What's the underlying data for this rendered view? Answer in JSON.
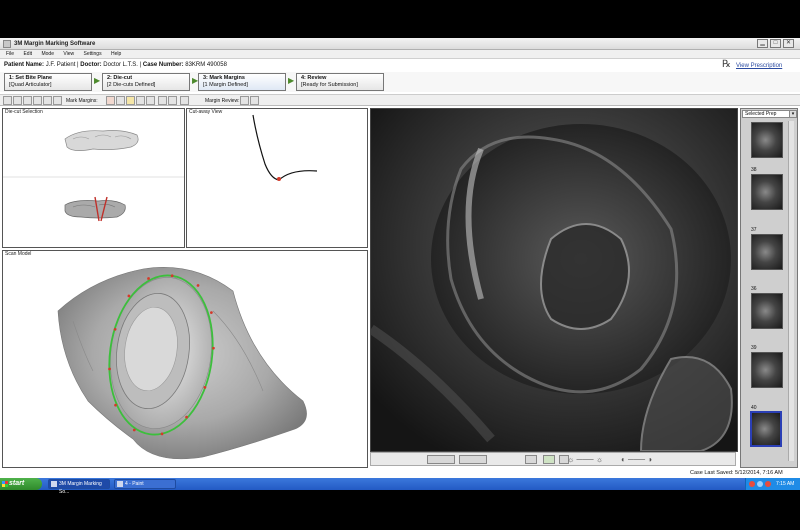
{
  "window": {
    "title": "3M Margin Marking Software"
  },
  "menu": [
    "File",
    "Edit",
    "Mode",
    "View",
    "Settings",
    "Help"
  ],
  "patient_bar": {
    "patient_label": "Patient Name:",
    "patient_value": "J.F. Patient",
    "doctor_label": "Doctor:",
    "doctor_value": "Doctor L.T.S.",
    "case_label": "Case Number:",
    "case_value": "83KRM 490058",
    "separator": "|",
    "view_prescription": "View Prescription"
  },
  "steps": [
    {
      "title": "1: Set Bite Plane",
      "sub": "[Quad Articulator]"
    },
    {
      "title": "2: Die-cut",
      "sub": "[2 Die-cuts Defined]"
    },
    {
      "title": "3: Mark Margins",
      "sub": "[1 Margin Defined]"
    },
    {
      "title": "4: Review",
      "sub": "[Ready for Submission]"
    }
  ],
  "toolbar": {
    "mark_margins_label": "Mark Margins:",
    "margin_review_label": "Margin Review:"
  },
  "panels": {
    "diecut": "Die-cut Selection",
    "cutaway": "Cut-away View",
    "scan": "Scan Model"
  },
  "thumbnails": {
    "dropdown_value": "Selected Prep",
    "items": [
      {
        "label": ""
      },
      {
        "label": "38"
      },
      {
        "label": "37"
      },
      {
        "label": "36"
      },
      {
        "label": "39"
      },
      {
        "label": "40"
      }
    ]
  },
  "status": {
    "last_saved": "Case Last Saved: 5/12/2014, 7:16 AM"
  },
  "taskbar": {
    "start": "start",
    "tasks": [
      "3M Margin Marking So...",
      "4 - Paint"
    ],
    "clock": "7:15 AM"
  },
  "colors": {
    "margin_line": "#3cbf3c",
    "margin_points": "#d43a2a",
    "selected_thumb": "#2b3fb5",
    "taskbar": "#235ac4"
  }
}
